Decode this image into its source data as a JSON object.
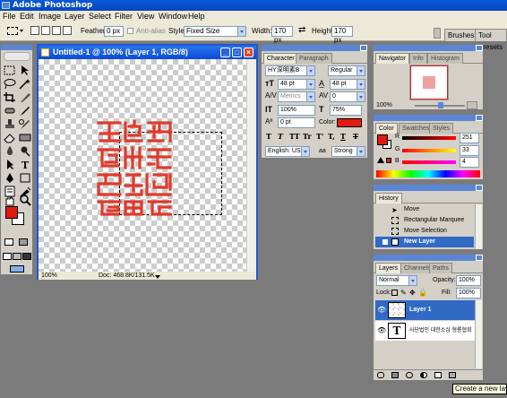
{
  "app": {
    "title": "Adobe Photoshop"
  },
  "menu": [
    "File",
    "Edit",
    "Image",
    "Layer",
    "Select",
    "Filter",
    "View",
    "Window",
    "Help"
  ],
  "options": {
    "feather_label": "Feather:",
    "feather_value": "0 px",
    "antialias_label": "Anti-alias",
    "style_label": "Style:",
    "style_value": "Fixed Size",
    "width_label": "Width:",
    "width_value": "170 px",
    "height_label": "Height:",
    "height_value": "170 px",
    "well_tabs": [
      "Brushes",
      "Tool Presets"
    ]
  },
  "document": {
    "title": "Untitled-1 @ 100% (Layer 1, RGB/8)",
    "zoom": "100%",
    "doc_info": "Doc: 468.8K/131.5K",
    "seal_color": "#e0392b"
  },
  "toolbox": {
    "foreground": "#e11b0f",
    "background": "#ffffff"
  },
  "character": {
    "tabs": [
      "Character",
      "Paragraph"
    ],
    "font_family": "HY深明素B",
    "font_style": "Regular",
    "font_size": "48 pt",
    "leading": "48 pt",
    "kerning": "Metrics",
    "tracking": "0",
    "vscale": "100%",
    "hscale": "75%",
    "baseline": "0 pt",
    "color_label": "Color:",
    "color": "#e11b0f",
    "style_buttons": [
      "T",
      "T",
      "TT",
      "Tr",
      "T'",
      "T,",
      "T",
      "T"
    ],
    "language": "English: USA",
    "aa_label": "aa",
    "antialias": "Strong"
  },
  "navigator": {
    "tabs": [
      "Navigator",
      "Info",
      "Histogram"
    ],
    "zoom": "100%"
  },
  "color": {
    "tabs": [
      "Color",
      "Swatches",
      "Styles"
    ],
    "r_label": "R",
    "g_label": "G",
    "b_label": "B",
    "r": "251",
    "g": "33",
    "b": "4"
  },
  "history": {
    "tabs": [
      "History"
    ],
    "items": [
      "Move",
      "Rectangular Marquee",
      "Move Selection",
      "New Layer"
    ]
  },
  "layers": {
    "tabs": [
      "Layers",
      "Channels",
      "Paths"
    ],
    "blend_mode": "Normal",
    "opacity_label": "Opacity:",
    "opacity": "100%",
    "lock_label": "Lock:",
    "fill_label": "Fill:",
    "fill": "100%",
    "items": [
      {
        "name": "Layer 1",
        "selected": true,
        "kind": "raster"
      },
      {
        "name": "사단법인 대한소심 형룡협회",
        "selected": false,
        "kind": "text"
      }
    ]
  },
  "tooltip": "Create a new layer"
}
